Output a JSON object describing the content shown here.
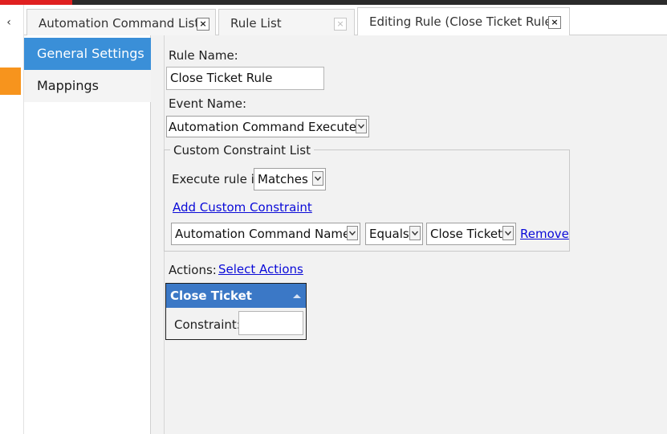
{
  "tabs": [
    {
      "label": "Automation Command List"
    },
    {
      "label": "Rule List"
    },
    {
      "label": "Editing Rule (Close Ticket Rule)"
    }
  ],
  "tab_close_glyph": "×",
  "sidebar": {
    "collapse_glyph": "‹",
    "items": [
      {
        "label": "General Settings",
        "active": true
      },
      {
        "label": "Mappings",
        "active": false
      }
    ]
  },
  "form": {
    "rule_name_label": "Rule Name:",
    "rule_name_value": "Close Ticket Rule",
    "event_name_label": "Event Name:",
    "event_name_value": "Automation Command Executed",
    "constraints": {
      "group_title": "Custom Constraint List",
      "execute_label": "Execute rule if",
      "execute_value": "Matches",
      "add_link": "Add Custom Constraint",
      "row": {
        "field": "Automation Command Name",
        "operator": "Equals",
        "value": "Close Ticket",
        "remove_link": "Remove"
      }
    },
    "actions": {
      "label": "Actions:",
      "select_link": "Select Actions",
      "items": [
        {
          "title": "Close Ticket",
          "constraint_label": "Constraint:",
          "constraint_value": ""
        }
      ]
    }
  },
  "colors": {
    "accent_blue": "#3a8fd8",
    "action_header": "#3b78c6",
    "link": "#0a0ad8",
    "orange_marker": "#f7941d",
    "top_red": "#e02020"
  }
}
